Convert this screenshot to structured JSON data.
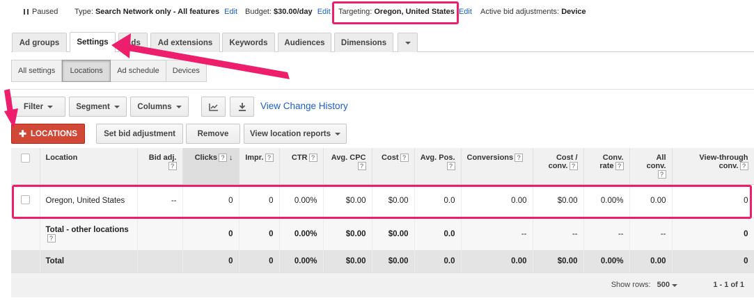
{
  "status": {
    "state": "Paused",
    "type_label": "Type:",
    "type_value": "Search Network only - All features",
    "budget_label": "Budget:",
    "budget_value": "$30.00/day",
    "targeting_label": "Targeting:",
    "targeting_value": "Oregon, United States",
    "adjust_label": "Active bid adjustments:",
    "adjust_value": "Device",
    "edit_label": "Edit"
  },
  "tabs": [
    "Ad groups",
    "Settings",
    "Ads",
    "Ad extensions",
    "Keywords",
    "Audiences",
    "Dimensions"
  ],
  "subtabs": [
    "All settings",
    "Locations",
    "Ad schedule",
    "Devices"
  ],
  "toolbar": {
    "filter": "Filter",
    "segment": "Segment",
    "columns": "Columns",
    "chart_icon": "line-chart-icon",
    "download_icon": "download-icon",
    "history_link": "View Change History",
    "add_locations": "LOCATIONS",
    "set_bid": "Set bid adjustment",
    "remove": "Remove",
    "view_reports": "View location reports"
  },
  "table": {
    "headers": {
      "location": "Location",
      "bid_adj": "Bid adj.",
      "clicks": "Clicks",
      "impr": "Impr.",
      "ctr": "CTR",
      "avg_cpc": "Avg. CPC",
      "cost": "Cost",
      "avg_pos": "Avg. Pos.",
      "conversions": "Conversions",
      "cost_conv": "Cost / conv.",
      "conv_rate": "Conv. rate",
      "all_conv": "All conv.",
      "view_through": "View-through conv."
    },
    "rows": [
      {
        "location": "Oregon, United States",
        "bid_adj": "--",
        "clicks": "0",
        "impr": "0",
        "ctr": "0.00%",
        "avg_cpc": "$0.00",
        "cost": "$0.00",
        "avg_pos": "0.0",
        "conversions": "0.00",
        "cost_conv": "$0.00",
        "conv_rate": "0.00%",
        "all_conv": "0.00",
        "view_through": "0"
      },
      {
        "location": "Total - other locations",
        "bid_adj": "",
        "clicks": "0",
        "impr": "0",
        "ctr": "0.00%",
        "avg_cpc": "$0.00",
        "cost": "$0.00",
        "avg_pos": "0.0",
        "conversions": "--",
        "cost_conv": "--",
        "conv_rate": "--",
        "all_conv": "--",
        "view_through": "0"
      },
      {
        "location": "Total",
        "bid_adj": "",
        "clicks": "0",
        "impr": "0",
        "ctr": "0.00%",
        "avg_cpc": "$0.00",
        "cost": "$0.00",
        "avg_pos": "0.0",
        "conversions": "0.00",
        "cost_conv": "$0.00",
        "conv_rate": "0.00%",
        "all_conv": "0.00",
        "view_through": "0"
      }
    ]
  },
  "footer": {
    "show_rows_label": "Show rows:",
    "show_rows_value": "500",
    "range": "1 - 1 of 1"
  },
  "help_glyph": "?",
  "annotation_color": "#ed1e6b"
}
